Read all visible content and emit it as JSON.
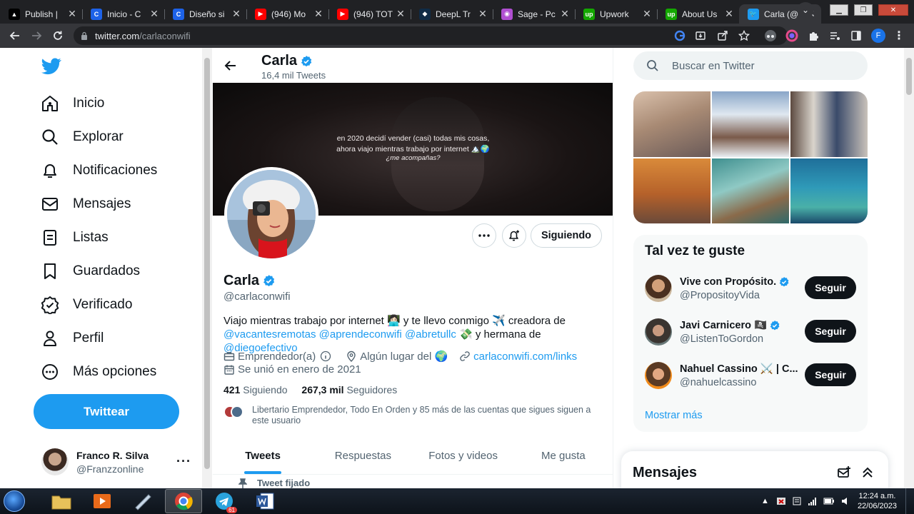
{
  "browser": {
    "tabs": [
      {
        "title": "Publish |",
        "icon": "pen-icon",
        "color": "#000000",
        "active": false
      },
      {
        "title": "Inicio - C",
        "icon": "circle-c-icon",
        "color": "#1d62e8",
        "active": false
      },
      {
        "title": "Diseño si",
        "icon": "circle-c-icon",
        "color": "#1d62e8",
        "active": false
      },
      {
        "title": "(946) Mo",
        "icon": "youtube-icon",
        "color": "#ff0000",
        "active": false
      },
      {
        "title": "(946) TOT",
        "icon": "youtube-icon",
        "color": "#ff0000",
        "active": false
      },
      {
        "title": "DeepL Tr",
        "icon": "deepl-icon",
        "color": "#0f2b46",
        "active": false
      },
      {
        "title": "Sage - Pc",
        "icon": "sage-icon",
        "color": "#b04fd1",
        "active": false
      },
      {
        "title": "Upwork",
        "icon": "upwork-icon",
        "color": "#14a800",
        "active": false
      },
      {
        "title": "About Us",
        "icon": "upwork-icon",
        "color": "#14a800",
        "active": false
      },
      {
        "title": "Carla (@",
        "icon": "twitter-icon",
        "color": "#1d9bf0",
        "active": true
      }
    ],
    "url_host": "twitter.com",
    "url_path": "/carlaconwifi",
    "profile_initial": "F"
  },
  "left_nav": {
    "items": [
      {
        "label": "Inicio",
        "icon": "home-icon"
      },
      {
        "label": "Explorar",
        "icon": "search-icon"
      },
      {
        "label": "Notificaciones",
        "icon": "bell-icon"
      },
      {
        "label": "Mensajes",
        "icon": "mail-icon"
      },
      {
        "label": "Listas",
        "icon": "list-icon"
      },
      {
        "label": "Guardados",
        "icon": "bookmark-icon"
      },
      {
        "label": "Verificado",
        "icon": "verified-icon"
      },
      {
        "label": "Perfil",
        "icon": "person-icon"
      },
      {
        "label": "Más opciones",
        "icon": "more-circle-icon"
      }
    ],
    "tweet_button": "Twittear",
    "account": {
      "name": "Franco R. Silva",
      "handle": "@Franzzonline"
    }
  },
  "profile": {
    "header_name": "Carla",
    "tweet_count": "16,4 mil Tweets",
    "banner_text": [
      "en 2020 decidí vender (casi) todas mis cosas,",
      "ahora viajo mientras trabajo por internet 🏔️🌍",
      "¿me acompañas?"
    ],
    "following_button": "Siguiendo",
    "name": "Carla",
    "handle": "@carlaconwifi",
    "bio_text_1": "Viajo mientras trabajo por internet 👩🏻‍💻 y te llevo conmigo ✈️ creadora de",
    "bio_mention_1": "@vacantesremotas",
    "bio_mention_2": "@aprendeconwifi",
    "bio_mention_3": "@abretullc",
    "bio_text_2": "💸 y hermana de",
    "bio_mention_4": "@diegoefectivo",
    "category": "Emprendedor(a)",
    "location": "Algún lugar del 🌍",
    "website": "carlaconwifi.com/links",
    "joined": "Se unió en enero de 2021",
    "following_count": "421",
    "following_label": "Siguiendo",
    "followers_count": "267,3 mil",
    "followers_label": "Seguidores",
    "followed_by": "Libertario Emprendedor, Todo En Orden y 85 más de las cuentas que sigues siguen a este usuario",
    "tabs": [
      "Tweets",
      "Respuestas",
      "Fotos y videos",
      "Me gusta"
    ],
    "pinned_label": "Tweet fijado"
  },
  "right": {
    "search_placeholder": "Buscar en Twitter",
    "suggestions_title": "Tal vez te guste",
    "suggestions": [
      {
        "name": "Vive con Propósito.",
        "handle": "@PropositoyVida",
        "button": "Seguir",
        "verified": true
      },
      {
        "name": "Javi Carnicero 🏴‍☠️",
        "handle": "@ListenToGordon",
        "button": "Seguir",
        "verified": true
      },
      {
        "name": "Nahuel Cassino ⚔️ | C...",
        "handle": "@nahuelcassino",
        "button": "Seguir",
        "verified": false
      }
    ],
    "show_more": "Mostrar más",
    "messages_title": "Mensajes"
  },
  "taskbar": {
    "time": "12:24 a.m.",
    "date": "22/06/2023",
    "telegram_badge": "61"
  },
  "colors": {
    "twitter_blue": "#1d9bf0",
    "text_primary": "#0f1419",
    "text_secondary": "#536471"
  }
}
